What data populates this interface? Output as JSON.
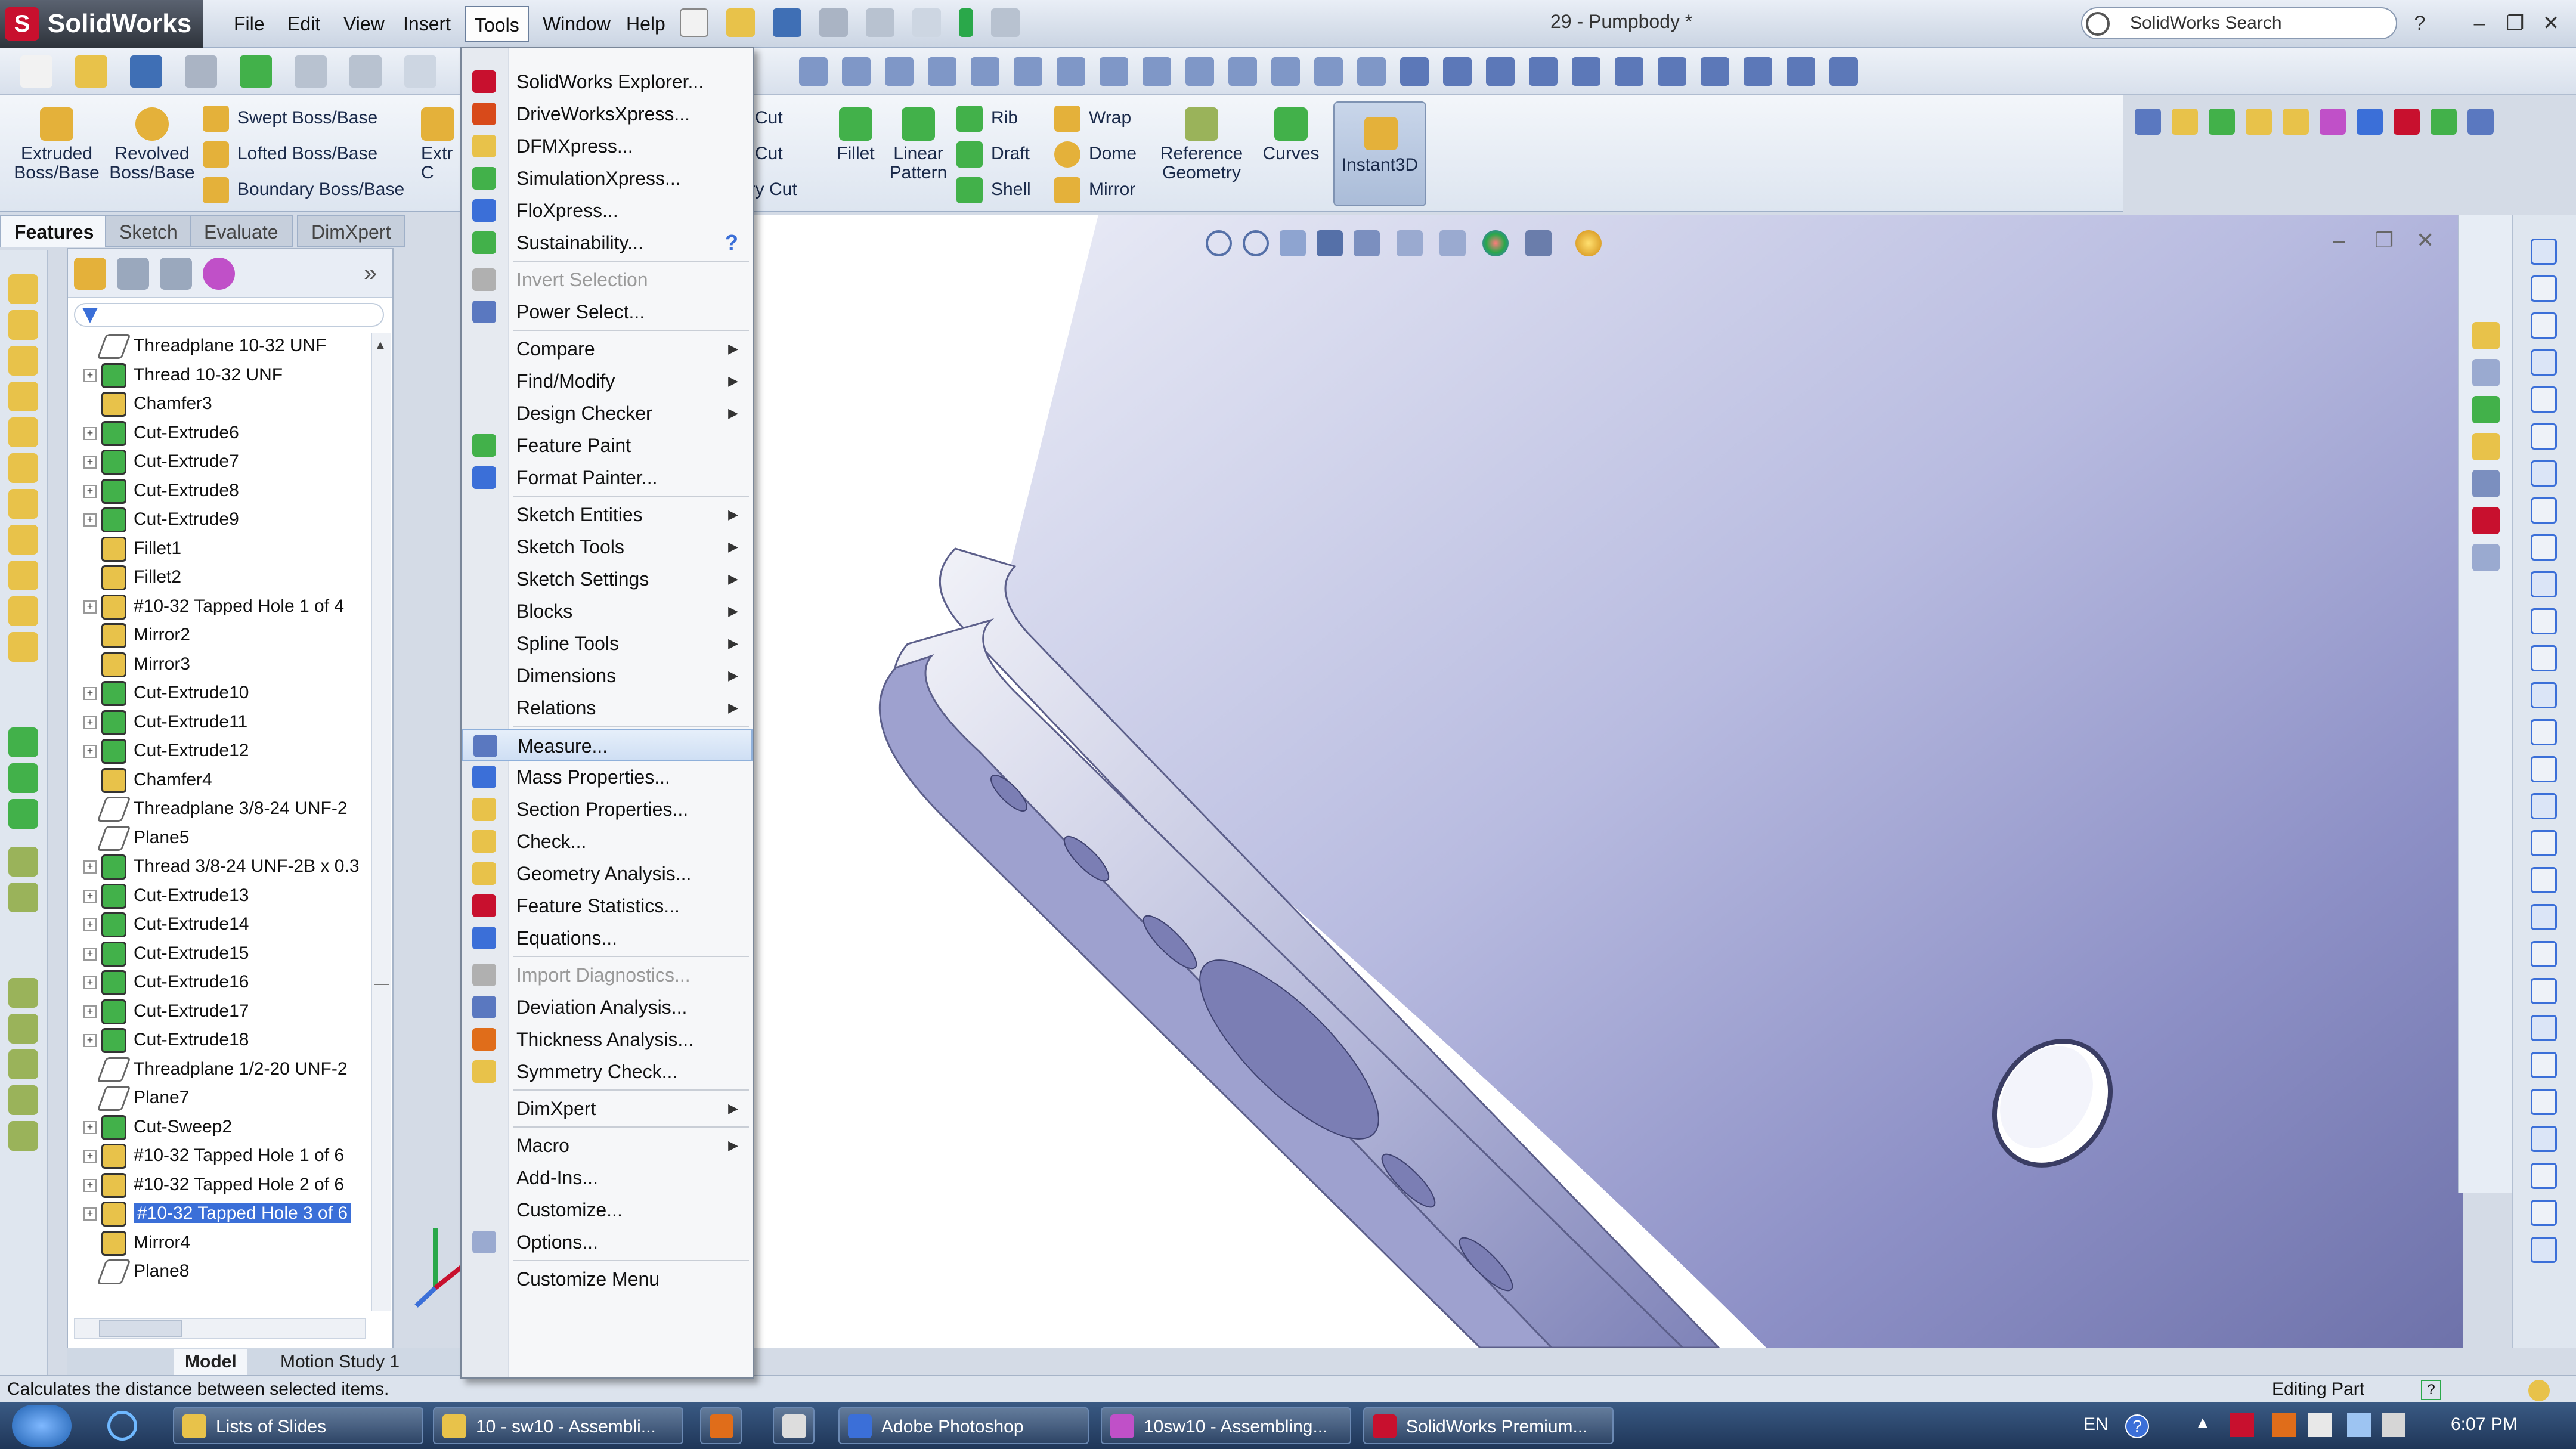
{
  "app": {
    "name": "SolidWorks",
    "document_title": "29 - Pumpbody *",
    "search_placeholder": "SolidWorks Search"
  },
  "menubar": [
    "File",
    "Edit",
    "View",
    "Insert",
    "Tools",
    "Window",
    "Help"
  ],
  "command_manager": {
    "big_buttons": [
      "Extruded Boss/Base",
      "Revolved Boss/Base",
      "Fillet",
      "Linear Pattern",
      "Reference Geometry",
      "Curves",
      "Instant3D"
    ],
    "small_buttons": [
      "Swept Boss/Base",
      "Lofted Boss/Base",
      "Boundary Boss/Base",
      "Cut",
      "Cut",
      "ary Cut",
      "Rib",
      "Draft",
      "Shell",
      "Wrap",
      "Dome",
      "Mirror"
    ],
    "clipped_labels": [
      "Extr",
      "C"
    ]
  },
  "tabs": [
    "Features",
    "Sketch",
    "Evaluate",
    "DimXpert"
  ],
  "feature_tree": [
    {
      "label": "Threadplane 10-32 UNF",
      "icon": "plane",
      "expandable": false
    },
    {
      "label": "Thread 10-32 UNF",
      "icon": "feature",
      "expandable": true
    },
    {
      "label": "Chamfer3",
      "icon": "chamfer",
      "expandable": false
    },
    {
      "label": "Cut-Extrude6",
      "icon": "feature",
      "expandable": true
    },
    {
      "label": "Cut-Extrude7",
      "icon": "feature",
      "expandable": true
    },
    {
      "label": "Cut-Extrude8",
      "icon": "feature",
      "expandable": true
    },
    {
      "label": "Cut-Extrude9",
      "icon": "feature",
      "expandable": true
    },
    {
      "label": "Fillet1",
      "icon": "chamfer",
      "expandable": false
    },
    {
      "label": "Fillet2",
      "icon": "chamfer",
      "expandable": false
    },
    {
      "label": "#10-32 Tapped Hole 1 of 4",
      "icon": "hole",
      "expandable": true
    },
    {
      "label": "Mirror2",
      "icon": "mirror",
      "expandable": false
    },
    {
      "label": "Mirror3",
      "icon": "mirror",
      "expandable": false
    },
    {
      "label": "Cut-Extrude10",
      "icon": "feature",
      "expandable": true
    },
    {
      "label": "Cut-Extrude11",
      "icon": "feature",
      "expandable": true
    },
    {
      "label": "Cut-Extrude12",
      "icon": "feature",
      "expandable": true
    },
    {
      "label": "Chamfer4",
      "icon": "chamfer",
      "expandable": false
    },
    {
      "label": "Threadplane 3/8-24 UNF-2",
      "icon": "plane",
      "expandable": false
    },
    {
      "label": "Plane5",
      "icon": "plane",
      "expandable": false
    },
    {
      "label": "Thread 3/8-24 UNF-2B x 0.3",
      "icon": "feature",
      "expandable": true
    },
    {
      "label": "Cut-Extrude13",
      "icon": "feature",
      "expandable": true
    },
    {
      "label": "Cut-Extrude14",
      "icon": "feature",
      "expandable": true
    },
    {
      "label": "Cut-Extrude15",
      "icon": "feature",
      "expandable": true
    },
    {
      "label": "Cut-Extrude16",
      "icon": "feature",
      "expandable": true
    },
    {
      "label": "Cut-Extrude17",
      "icon": "feature",
      "expandable": true
    },
    {
      "label": "Cut-Extrude18",
      "icon": "feature",
      "expandable": true
    },
    {
      "label": "Threadplane 1/2-20 UNF-2",
      "icon": "plane",
      "expandable": false
    },
    {
      "label": "Plane7",
      "icon": "plane",
      "expandable": false
    },
    {
      "label": "Cut-Sweep2",
      "icon": "feature",
      "expandable": true
    },
    {
      "label": "#10-32 Tapped Hole 1 of 6",
      "icon": "hole",
      "expandable": true
    },
    {
      "label": "#10-32 Tapped Hole 2 of 6",
      "icon": "hole",
      "expandable": true
    },
    {
      "label": "#10-32 Tapped Hole 3 of 6",
      "icon": "hole",
      "expandable": true,
      "selected": true
    },
    {
      "label": "Mirror4",
      "icon": "mirror",
      "expandable": false
    },
    {
      "label": "Plane8",
      "icon": "plane",
      "expandable": false
    }
  ],
  "tools_menu": [
    {
      "label": "SolidWorks Explorer...",
      "icon": "explorer"
    },
    {
      "label": "DriveWorksXpress...",
      "icon": "driveworks"
    },
    {
      "label": "DFMXpress...",
      "icon": "dfm"
    },
    {
      "label": "SimulationXpress...",
      "icon": "simulation"
    },
    {
      "label": "FloXpress...",
      "icon": "flo"
    },
    {
      "label": "Sustainability...",
      "icon": "sustainability",
      "help": true
    },
    {
      "sep": true
    },
    {
      "label": "Invert Selection",
      "icon": "invert",
      "disabled": true
    },
    {
      "label": "Power Select...",
      "icon": "powerselect"
    },
    {
      "sep": true
    },
    {
      "label": "Compare",
      "submenu": true
    },
    {
      "label": "Find/Modify",
      "submenu": true
    },
    {
      "label": "Design Checker",
      "submenu": true
    },
    {
      "label": "Feature Paint",
      "icon": "featurepaint"
    },
    {
      "label": "Format Painter...",
      "icon": "formatpainter"
    },
    {
      "sep": true
    },
    {
      "label": "Sketch Entities",
      "submenu": true
    },
    {
      "label": "Sketch Tools",
      "submenu": true
    },
    {
      "label": "Sketch Settings",
      "submenu": true
    },
    {
      "label": "Blocks",
      "submenu": true
    },
    {
      "label": "Spline Tools",
      "submenu": true
    },
    {
      "label": "Dimensions",
      "submenu": true
    },
    {
      "label": "Relations",
      "submenu": true
    },
    {
      "sep": true
    },
    {
      "label": "Measure...",
      "icon": "measure",
      "highlighted": true
    },
    {
      "label": "Mass Properties...",
      "icon": "mass"
    },
    {
      "label": "Section Properties...",
      "icon": "section"
    },
    {
      "label": "Check...",
      "icon": "check"
    },
    {
      "label": "Geometry Analysis...",
      "icon": "geometry"
    },
    {
      "label": "Feature Statistics...",
      "icon": "statistics"
    },
    {
      "label": "Equations...",
      "icon": "equations"
    },
    {
      "sep": true
    },
    {
      "label": "Import Diagnostics...",
      "icon": "import",
      "disabled": true
    },
    {
      "label": "Deviation  Analysis...",
      "icon": "deviation"
    },
    {
      "label": "Thickness Analysis...",
      "icon": "thickness"
    },
    {
      "label": "Symmetry Check...",
      "icon": "symmetry"
    },
    {
      "sep": true
    },
    {
      "label": "DimXpert",
      "submenu": true
    },
    {
      "sep": true
    },
    {
      "label": "Macro",
      "submenu": true
    },
    {
      "label": "Add-Ins..."
    },
    {
      "label": "Customize..."
    },
    {
      "label": "Options...",
      "icon": "options"
    },
    {
      "sep": true
    },
    {
      "label": "Customize Menu"
    }
  ],
  "bottom_tabs": [
    "Model",
    "Motion Study 1"
  ],
  "status": {
    "message": "Calculates the distance between selected items.",
    "mode": "Editing Part"
  },
  "taskbar": {
    "items": [
      "Lists of Slides",
      "10 - sw10 - Assembli...",
      "",
      "",
      "Adobe Photoshop",
      "10sw10 - Assembling...",
      "SolidWorks Premium..."
    ],
    "language": "EN",
    "clock": "6:07 PM"
  },
  "colors": {
    "selection": "#3b6fd8",
    "titlebar": "#cbd5e3",
    "taskbar": "#1f3658",
    "model_shade": "#8b8fc8"
  }
}
